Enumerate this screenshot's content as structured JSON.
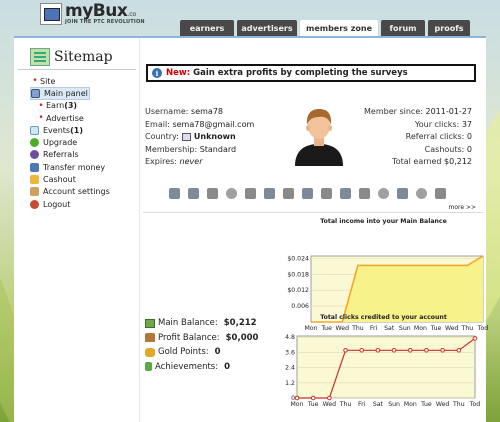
{
  "header": {
    "logo_name": "myBux",
    "logo_tld": ".co",
    "logo_tagline": "JOIN THE PTC REVOLUTION",
    "tabs": [
      {
        "label": "earners"
      },
      {
        "label": "advertisers"
      },
      {
        "label": "members zone",
        "active": true
      },
      {
        "label": "forum"
      },
      {
        "label": "proofs"
      }
    ]
  },
  "sidebar": {
    "title": "Sitemap",
    "items": [
      {
        "label": "Site",
        "icon": "bullet"
      },
      {
        "label": "Main panel",
        "icon": "panel-icon",
        "selected": true
      },
      {
        "label": "Earn",
        "count": "(3)",
        "icon": "bullet"
      },
      {
        "label": "Advertise",
        "icon": "bullet"
      },
      {
        "label": "Events",
        "count": "(1)",
        "icon": "events-icon"
      },
      {
        "label": "Upgrade",
        "icon": "upgrade-icon"
      },
      {
        "label": "Referrals",
        "icon": "referrals-icon"
      },
      {
        "label": "Transfer money",
        "icon": "transfer-icon"
      },
      {
        "label": "Cashout",
        "icon": "cashout-icon"
      },
      {
        "label": "Account settings",
        "icon": "settings-icon"
      },
      {
        "label": "Logout",
        "icon": "logout-icon"
      }
    ]
  },
  "notice": {
    "new_label": "New:",
    "text": "Gain extra profits by completing the surveys"
  },
  "profile": {
    "username_label": "Username:",
    "username": "sema78",
    "email_label": "Email:",
    "email": "sema78@gmail.com",
    "country_label": "Country:",
    "country": "Unknown",
    "membership_label": "Membership:",
    "membership": "Standard",
    "expires_label": "Expires:",
    "expires": "never"
  },
  "stats": {
    "member_since_label": "Member since:",
    "member_since": "2011-01-27",
    "your_clicks_label": "Your clicks:",
    "your_clicks": "37",
    "referral_clicks_label": "Referral clicks:",
    "referral_clicks": "0",
    "cashouts_label": "Cashouts:",
    "cashouts": "0",
    "total_earned_label": "Total earned",
    "total_earned": "$0,212"
  },
  "toolbar": {
    "icons": [
      "flag-icon",
      "flag-icon",
      "page-icon",
      "spade-icon",
      "bucket-icon",
      "cart-icon",
      "truck-icon",
      "grid-icon",
      "calendar-icon",
      "window-icon",
      "window-icon",
      "people-icon",
      "people-icon",
      "users-icon",
      "person-icon"
    ],
    "more_label": "more >>"
  },
  "balances": {
    "main_label": "Main Balance:",
    "main_value": "$0,212",
    "profit_label": "Profit Balance:",
    "profit_value": "$0,000",
    "gold_label": "Gold Points:",
    "gold_value": "0",
    "achievements_label": "Achievements:",
    "achievements_value": "0"
  },
  "chart_data": [
    {
      "type": "area",
      "title": "Total income into your Main Balance",
      "categories": [
        "Mon",
        "Tue",
        "Wed",
        "Thu",
        "Fri",
        "Sat",
        "Sun",
        "Mon",
        "Tue",
        "Wed",
        "Thu",
        "Tod"
      ],
      "values": [
        0,
        0,
        0,
        0.024,
        0.024,
        0.024,
        0.024,
        0.024,
        0.024,
        0.024,
        0.024,
        0.028
      ],
      "yticks": [
        "0.006",
        "$0.012",
        "$0.018",
        "$0.024"
      ],
      "ylim": [
        0,
        0.028
      ],
      "colors": {
        "line": "#f2a72a",
        "fill": "#f7f28a",
        "bg": "#fbf8d4"
      }
    },
    {
      "type": "line",
      "title": "Total clicks credited to your account",
      "categories": [
        "Mon",
        "Tue",
        "Wed",
        "Thu",
        "Fri",
        "Sat",
        "Sun",
        "Mon",
        "Tue",
        "Wed",
        "Thu",
        "Tod"
      ],
      "values": [
        0,
        0,
        0,
        4,
        4,
        4,
        4,
        4,
        4,
        4,
        4,
        5
      ],
      "yticks": [
        "0",
        "1.2",
        "2.4",
        "3.6",
        "4.8"
      ],
      "ylim": [
        0,
        5.2
      ],
      "colors": {
        "line": "#c8312a",
        "bg": "#fbf8d4"
      }
    }
  ]
}
